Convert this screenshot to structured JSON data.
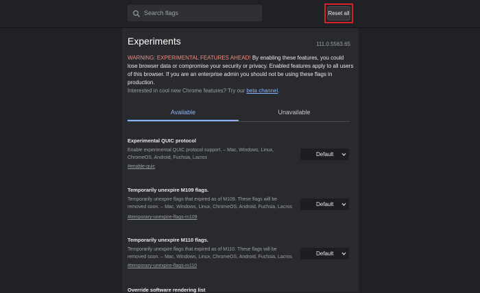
{
  "search": {
    "placeholder": "Search flags",
    "icon": "search-icon"
  },
  "reset_all_label": "Reset all",
  "highlight_color": "#d8232a",
  "header": {
    "title": "Experiments",
    "version": "111.0.5563.65"
  },
  "warning": {
    "heading": "WARNING: EXPERIMENTAL FEATURES AHEAD!",
    "body": " By enabling these features, you could lose browser data or compromise your security or privacy. Enabled features apply to all users of this browser. If you are an enterprise admin you should not be using these flags in production."
  },
  "interest": {
    "text": "Interested in cool new Chrome features? Try our ",
    "link": "beta channel",
    "suffix": "."
  },
  "tabs": [
    {
      "label": "Available",
      "active": true
    },
    {
      "label": "Unavailable",
      "active": false
    }
  ],
  "flags": [
    {
      "name": "Experimental QUIC protocol",
      "description": "Enable experimental QUIC protocol support. – Mac, Windows, Linux, ChromeOS, Android, Fuchsia, Lacros",
      "link": "#enable-quic",
      "value": "Default"
    },
    {
      "name": "Temporarily unexpire M109 flags.",
      "description": "Temporarily unexpire flags that expired as of M109. These flags will be removed soon. – Mac, Windows, Linux, ChromeOS, Android, Fuchsia, Lacros",
      "link": "#temporary-unexpire-flags-m109",
      "value": "Default"
    },
    {
      "name": "Temporarily unexpire M110 flags.",
      "description": "Temporarily unexpire flags that expired as of M110. These flags will be removed soon. – Mac, Windows, Linux, ChromeOS, Android, Fuchsia, Lacros",
      "link": "#temporary-unexpire-flags-m110",
      "value": "Default"
    },
    {
      "name": "Override software rendering list"
    }
  ],
  "colors": {
    "accent": "#8ab4f8",
    "warning": "#f28b82",
    "background": "#202124",
    "panel": "#292a2d"
  }
}
